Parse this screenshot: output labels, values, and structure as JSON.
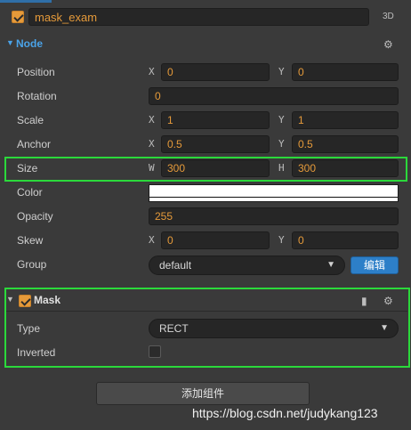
{
  "node": {
    "enabled": true,
    "name": "mask_exam",
    "tag_3d": "3D"
  },
  "node_section": {
    "title": "Node",
    "position": {
      "label": "Position",
      "x_axis": "X",
      "x": "0",
      "y_axis": "Y",
      "y": "0"
    },
    "rotation": {
      "label": "Rotation",
      "value": "0"
    },
    "scale": {
      "label": "Scale",
      "x_axis": "X",
      "x": "1",
      "y_axis": "Y",
      "y": "1"
    },
    "anchor": {
      "label": "Anchor",
      "x_axis": "X",
      "x": "0.5",
      "y_axis": "Y",
      "y": "0.5"
    },
    "size": {
      "label": "Size",
      "w_axis": "W",
      "w": "300",
      "h_axis": "H",
      "h": "300"
    },
    "color": {
      "label": "Color",
      "value_hex": "#ffffff"
    },
    "opacity": {
      "label": "Opacity",
      "value": "255"
    },
    "skew": {
      "label": "Skew",
      "x_axis": "X",
      "x": "0",
      "y_axis": "Y",
      "y": "0"
    },
    "group": {
      "label": "Group",
      "value": "default",
      "edit_label": "编辑"
    }
  },
  "mask_section": {
    "title": "Mask",
    "enabled": true,
    "type": {
      "label": "Type",
      "value": "RECT"
    },
    "inverted": {
      "label": "Inverted",
      "checked": false
    }
  },
  "add_component_label": "添加组件",
  "watermark": "https://blog.csdn.net/judykang123",
  "colors": {
    "accent_orange": "#e59a3a",
    "highlight_green": "#2bd93b",
    "edit_button_blue": "#2d7fc8",
    "node_title_blue": "#4aa3e8"
  }
}
